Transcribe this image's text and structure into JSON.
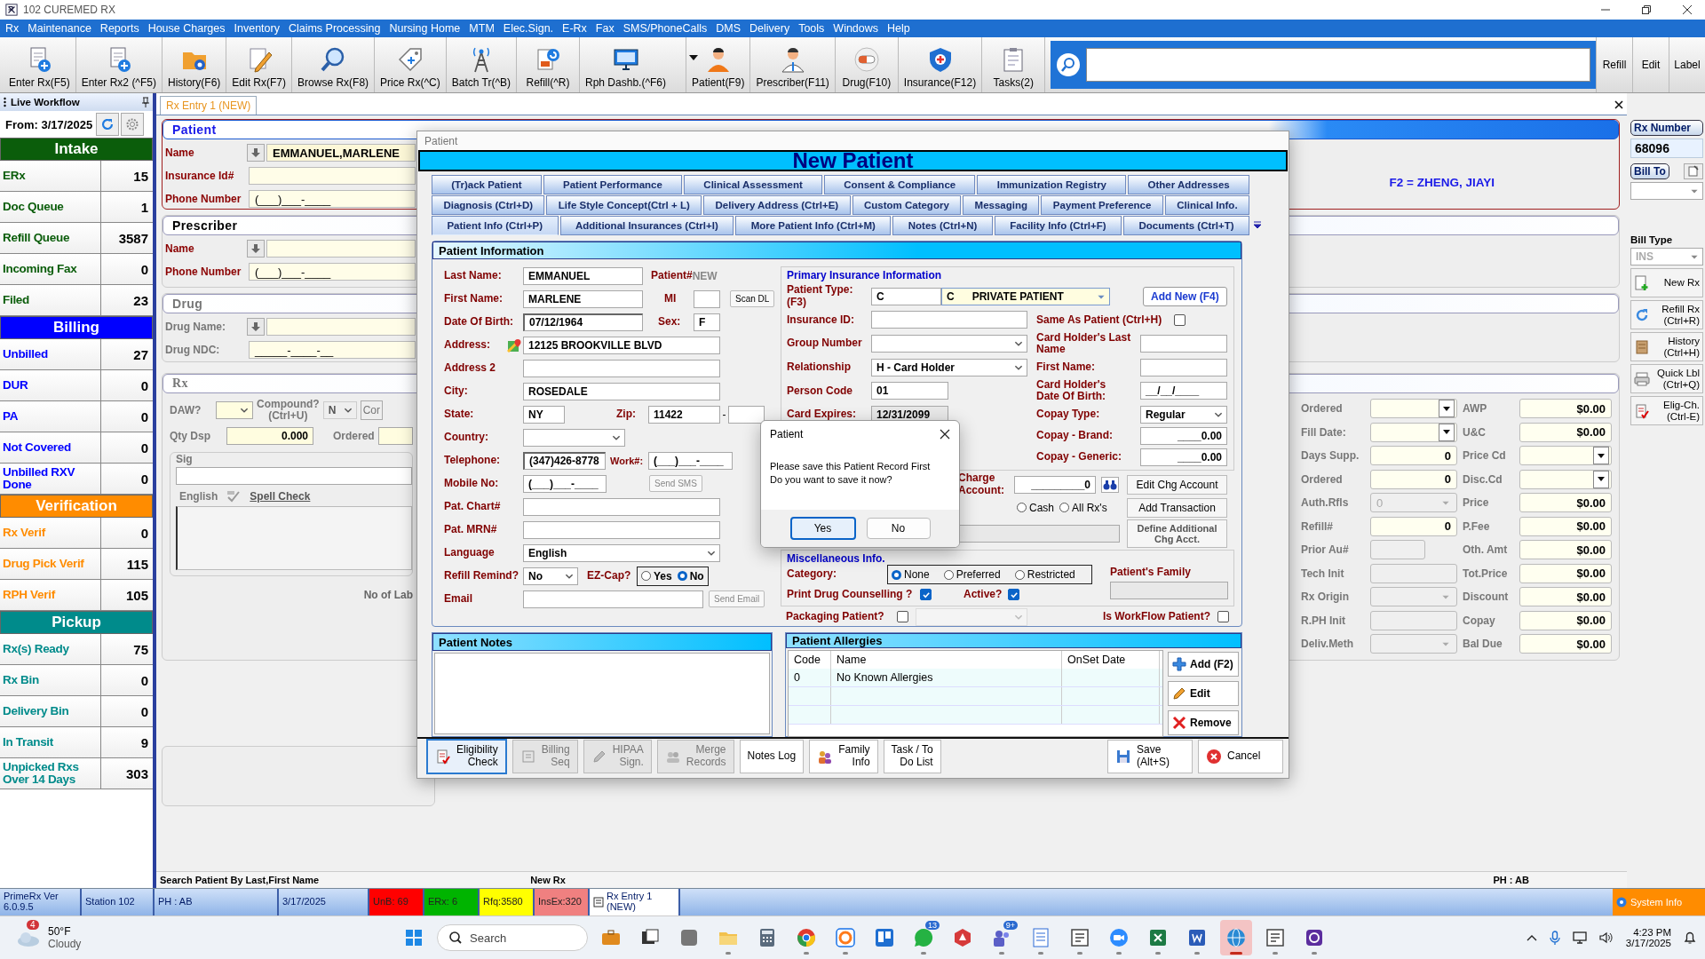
{
  "window": {
    "title": "102 CUREMED RX"
  },
  "menu": [
    "Rx",
    "Maintenance",
    "Reports",
    "House Charges",
    "Inventory",
    "Claims Processing",
    "Nursing Home",
    "MTM",
    "Elec.Sign.",
    "E-Rx",
    "Fax",
    "SMS/PhoneCalls",
    "DMS",
    "Delivery",
    "Tools",
    "Windows",
    "Help"
  ],
  "toolbar": [
    "Enter Rx(F5)",
    "Enter Rx2 (^F5)",
    "History(F6)",
    "Edit Rx(F7)",
    "Browse Rx(F8)",
    "Price Rx(^C)",
    "Batch Tr(^B)",
    "Refill(^R)",
    "Rph Dashb.(^F6)",
    "Patient(F9)",
    "Prescriber(F11)",
    "Drug(F10)",
    "Insurance(F12)",
    "Tasks(2)"
  ],
  "toolbar_buttons": [
    "Refill",
    "Edit",
    "Label"
  ],
  "sidebar": {
    "title": "Live Workflow",
    "from": "From: 3/17/2025",
    "groups": [
      {
        "title": "Intake",
        "color": "#0b5d0b",
        "items": [
          {
            "label": "ERx",
            "count": "15"
          },
          {
            "label": "Doc Queue",
            "count": "1"
          },
          {
            "label": "Refill Queue",
            "count": "3587"
          },
          {
            "label": "Incoming Fax",
            "count": "0"
          },
          {
            "label": "Filed",
            "count": "23"
          }
        ]
      },
      {
        "title": "Billing",
        "color": "#0000ff",
        "items": [
          {
            "label": "Unbilled",
            "count": "27"
          },
          {
            "label": "DUR",
            "count": "0"
          },
          {
            "label": "PA",
            "count": "0"
          },
          {
            "label": "Not Covered",
            "count": "0"
          },
          {
            "label": "Unbilled RXV Done",
            "count": "0"
          }
        ]
      },
      {
        "title": "Verification",
        "color": "#ff8c00",
        "items": [
          {
            "label": "Rx Verif",
            "count": "0"
          },
          {
            "label": "Drug Pick Verif",
            "count": "115"
          },
          {
            "label": "RPH Verif",
            "count": "105"
          }
        ]
      },
      {
        "title": "Pickup",
        "color": "#008b8b",
        "items": [
          {
            "label": "Rx(s) Ready",
            "count": "75"
          },
          {
            "label": "Rx Bin",
            "count": "0"
          },
          {
            "label": "Delivery Bin",
            "count": "0"
          },
          {
            "label": "In Transit",
            "count": "9"
          },
          {
            "label": "Unpicked Rxs Over 14 Days",
            "count": "303"
          }
        ]
      }
    ]
  },
  "tabs": [
    {
      "label": "Rx Entry 1 (NEW)",
      "selected": true
    }
  ],
  "patient_panel": {
    "title": "Patient",
    "fields": [
      {
        "label": "Name",
        "value": "EMMANUEL,MARLENE",
        "lookup": true
      },
      {
        "label": "Insurance Id#",
        "lookup": false
      },
      {
        "label": "Phone Number",
        "value": "(___)___-____",
        "lookup": false
      }
    ],
    "prescriber_note": "F2 = ZHENG, JIAYI"
  },
  "prescriber_panel": {
    "title": "Prescriber",
    "fields": [
      {
        "label": "Name",
        "lookup": true
      },
      {
        "label": "Phone Number",
        "value": "(___)___-____",
        "lookup": false
      }
    ]
  },
  "drug_panel": {
    "title": "Drug",
    "fields": [
      {
        "label": "Drug Name:",
        "lookup": true
      },
      {
        "label": "Drug NDC:",
        "value": "_____-____-__",
        "lookup": false
      }
    ]
  },
  "rx_panel": {
    "title": "Rx",
    "daw_label": "DAW?",
    "compound_label": "Compound?\n(Ctrl+U)",
    "compound_value": "N",
    "compound_button": "Cor",
    "qty_label": "Qty Dsp",
    "qty_value": "0.000",
    "ordered_label": "Ordered",
    "sig_label": "Sig",
    "language": "English",
    "spell_check": "Spell Check",
    "labels_text": "No of Lab"
  },
  "pricing": {
    "left": [
      {
        "label": "Ordered",
        "kind": "dropdown"
      },
      {
        "label": "Fill Date:",
        "kind": "dropdown"
      },
      {
        "label": "Days Supp.",
        "kind": "number",
        "value": "0"
      },
      {
        "label": "Ordered",
        "kind": "number",
        "value": "0"
      },
      {
        "label": "Auth.Rfls",
        "kind": "disabled",
        "value": "0"
      },
      {
        "label": "Refill#",
        "kind": "number",
        "value": "0"
      },
      {
        "label": "Prior Au#",
        "kind": "short"
      },
      {
        "label": "Tech Init",
        "kind": "blank"
      },
      {
        "label": "Rx Origin",
        "kind": "disabled"
      },
      {
        "label": "R.PH Init",
        "kind": "blank"
      },
      {
        "label": "Deliv.Meth",
        "kind": "disabled"
      }
    ],
    "right": [
      {
        "label": "AWP",
        "kind": "number",
        "value": "$0.00"
      },
      {
        "label": "U&C",
        "kind": "number",
        "value": "$0.00"
      },
      {
        "label": "Price Cd",
        "kind": "dropdown"
      },
      {
        "label": "Disc.Cd",
        "kind": "dropdown"
      },
      {
        "label": "Price",
        "kind": "number",
        "value": "$0.00"
      },
      {
        "label": "P.Fee",
        "kind": "number",
        "value": "$0.00"
      },
      {
        "label": "Oth. Amt",
        "kind": "number",
        "value": "$0.00"
      },
      {
        "label": "Tot.Price",
        "kind": "number",
        "value": "$0.00"
      },
      {
        "label": "Discount",
        "kind": "number",
        "value": "$0.00"
      },
      {
        "label": "Copay",
        "kind": "number",
        "value": "$0.00"
      },
      {
        "label": "Bal Due",
        "kind": "number",
        "value": "$0.00"
      }
    ]
  },
  "rail": {
    "rx_number_label": "Rx Number",
    "rx_number": "68096",
    "bill_to": "Bill To",
    "bill_type_label": "Bill Type",
    "bill_type": "INS",
    "actions": [
      "New Rx",
      "Refill Rx\n(Ctrl+R)",
      "History\n(Ctrl+H)",
      "Quick Lbl\n(Ctrl+Q)",
      "Elig-Ch.\n(Ctrl-E)"
    ]
  },
  "hints": [
    "Search Patient By Last,First Name",
    "New Rx",
    "PH : AB"
  ],
  "status_bar": [
    {
      "text": "PrimeRx Ver\n6.0.9.5"
    },
    {
      "text": "Station 102"
    },
    {
      "text": "PH : AB"
    },
    {
      "text": "3/17/2025"
    },
    {
      "text": "UnB: 69",
      "color": "#ff0000"
    },
    {
      "text": "ERx: 6",
      "color": "#00b400"
    },
    {
      "text": "Rfq:3580",
      "color": "#ffff00"
    },
    {
      "text": "InsEx:320",
      "color": "#f08080"
    },
    {
      "text": "Rx Entry 1\n(NEW)"
    }
  ],
  "system_info": "System Info",
  "taskbar": {
    "weather_badge": "4",
    "temperature": "50°F",
    "condition": "Cloudy",
    "search": {
      "placeholder": "Search"
    },
    "apps": [
      {
        "running": false,
        "selected": false
      },
      {
        "running": false,
        "selected": false
      },
      {
        "running": false,
        "selected": false
      },
      {
        "running": true,
        "selected": false
      },
      {
        "running": false,
        "selected": false
      },
      {
        "running": true,
        "selected": false
      },
      {
        "running": true,
        "selected": false
      },
      {
        "running": false,
        "selected": false
      },
      {
        "running": true,
        "selected": false,
        "badge": "13"
      },
      {
        "running": false,
        "selected": false
      },
      {
        "running": true,
        "selected": false,
        "badge": "9+"
      },
      {
        "running": true,
        "selected": false
      },
      {
        "running": true,
        "selected": false
      },
      {
        "running": true,
        "selected": false
      },
      {
        "running": true,
        "selected": false
      },
      {
        "running": true,
        "selected": false
      },
      {
        "running": true,
        "selected": true
      },
      {
        "running": true,
        "selected": false
      },
      {
        "running": true,
        "selected": false
      }
    ],
    "time": "4:23 PM",
    "date": "3/17/2025"
  },
  "dialog": {
    "title": "Patient",
    "heading": "New Patient",
    "tab_rows": [
      [
        {
          "label": "(Tr)ack Patient",
          "selected": false
        },
        {
          "label": "Patient Performance",
          "selected": false
        },
        {
          "label": "Clinical Assessment",
          "selected": false
        },
        {
          "label": "Consent & Compliance",
          "selected": false
        },
        {
          "label": "Immunization Registry",
          "selected": false
        },
        {
          "label": "Other Addresses",
          "selected": false
        }
      ],
      [
        {
          "label": "Diagnosis (Ctrl+D)",
          "selected": false
        },
        {
          "label": "Life Style Concept(Ctrl + L)",
          "selected": false
        },
        {
          "label": "Delivery Address (Ctrl+E)",
          "selected": false
        },
        {
          "label": "Custom Category",
          "selected": false
        },
        {
          "label": "Messaging",
          "selected": false
        },
        {
          "label": "Payment Preference",
          "selected": false
        },
        {
          "label": "Clinical Info.",
          "selected": false
        }
      ],
      [
        {
          "label": "Patient Info (Ctrl+P)",
          "selected": true
        },
        {
          "label": "Additional Insurances (Ctrl+I)",
          "selected": false
        },
        {
          "label": "More Patient Info (Ctrl+M)",
          "selected": false
        },
        {
          "label": "Notes (Ctrl+N)",
          "selected": false
        },
        {
          "label": "Facility Info (Ctrl+F)",
          "selected": false
        },
        {
          "label": "Documents (Ctrl+T)",
          "selected": false
        }
      ]
    ],
    "section_title": "Patient Information",
    "patient": {
      "last_name": {
        "label": "Last Name:",
        "value": "EMMANUEL"
      },
      "patient_no_label": "Patient#",
      "patient_no": "NEW",
      "first_name": {
        "label": "First Name:",
        "value": "MARLENE"
      },
      "mi_label": "MI",
      "scan_dl": "Scan DL",
      "dob": {
        "label": "Date Of Birth:",
        "value": "07/12/1964"
      },
      "sex": {
        "label": "Sex:",
        "value": "F"
      },
      "address": {
        "label": "Address:",
        "value": "12125 BROOKVILLE BLVD"
      },
      "address2": {
        "label": "Address 2"
      },
      "city": {
        "label": "City:",
        "value": "ROSEDALE"
      },
      "state": {
        "label": "State:",
        "value": "NY"
      },
      "zip": {
        "label": "Zip:",
        "value": "11422"
      },
      "zip_separator": "-",
      "country": {
        "label": "Country:"
      },
      "telephone": {
        "label": "Telephone:",
        "value": "(347)426-8778"
      },
      "work": {
        "label": "Work#:",
        "value": "(___)___-____"
      },
      "mobile": {
        "label": "Mobile No:",
        "value": "(___)___-____"
      },
      "send_sms": "Send SMS",
      "chart": {
        "label": "Pat. Chart#"
      },
      "mrn": {
        "label": "Pat. MRN#"
      },
      "language": {
        "label": "Language",
        "value": "English"
      },
      "refill_remind": {
        "label": "Refill Remind?",
        "value": "No"
      },
      "ez_cap": {
        "label": "EZ-Cap?",
        "options": [
          {
            "label": "Yes",
            "selected": false
          },
          {
            "label": "No",
            "selected": true
          }
        ]
      },
      "email": {
        "label": "Email"
      },
      "send_email": "Send Email"
    },
    "insurance": {
      "title": "Primary Insurance Information",
      "patient_type": {
        "label": "Patient Type:\n(F3)",
        "code": "C",
        "select_code": "C",
        "select_name": "PRIVATE PATIENT"
      },
      "add_new": "Add New (F4)",
      "insurance_id": {
        "label": "Insurance ID:"
      },
      "group_number": {
        "label": "Group Number"
      },
      "relationship": {
        "label": "Relationship",
        "value": "H - Card Holder"
      },
      "person_code": {
        "label": "Person Code",
        "value": "01"
      },
      "card_expires": {
        "label": "Card Expires:",
        "value": "12/31/2099"
      },
      "same_as_patient": {
        "label": "Same As Patient (Ctrl+H)",
        "checked": false
      },
      "holder_last": {
        "label": "Card Holder's Last\nName"
      },
      "holder_first": {
        "label": "First Name:"
      },
      "holder_dob": {
        "label": "Card Holder's\nDate Of Birth:",
        "value": "__/__/____"
      },
      "copay_type": {
        "label": "Copay Type:",
        "value": "Regular"
      },
      "copay_brand": {
        "label": "Copay - Brand:",
        "value": "____0.00"
      },
      "copay_generic": {
        "label": "Copay - Generic:",
        "value": "____0.00"
      }
    },
    "charge": {
      "label": "Charge\nAccount:",
      "value": "_________0",
      "edit": "Edit Chg Account",
      "options": [
        {
          "label": "Cash",
          "selected": false
        },
        {
          "label": "All Rx's",
          "selected": false
        }
      ],
      "add_transaction": "Add Transaction",
      "define": "Define Additional\nChg Acct."
    },
    "misc": {
      "title": "Miscellaneous Info.",
      "category_label": "Category:",
      "categories": [
        {
          "label": "None",
          "selected": true
        },
        {
          "label": "Preferred",
          "selected": false
        },
        {
          "label": "Restricted",
          "selected": false
        }
      ],
      "family_label": "Patient's Family",
      "print_counselling": {
        "label": "Print Drug Counselling ?",
        "checked": true
      },
      "active": {
        "label": "Active?",
        "checked": true
      },
      "packaging": {
        "label": "Packaging Patient?",
        "checked": false
      },
      "workflow": {
        "label": "Is WorkFlow Patient?",
        "checked": false
      }
    },
    "notes_title": "Patient Notes",
    "allergies": {
      "title": "Patient Allergies",
      "columns": [
        "Code",
        "Name",
        "OnSet Date"
      ],
      "rows": [
        {
          "code": "0",
          "name": "No Known Allergies"
        }
      ],
      "buttons": [
        "Add (F2)",
        "Edit",
        "Remove"
      ]
    },
    "footer_buttons": [
      {
        "label": "Eligibility\nCheck",
        "disabled": false
      },
      {
        "label": "Billing\nSeq",
        "disabled": true
      },
      {
        "label": "HIPAA\nSign.",
        "disabled": true
      },
      {
        "label": "Merge\nRecords",
        "disabled": true
      },
      {
        "label": "Notes Log",
        "disabled": false
      },
      {
        "label": "Family\nInfo",
        "disabled": false
      },
      {
        "label": "Task / To\nDo List",
        "disabled": false
      }
    ],
    "save": "Save\n(Alt+S)",
    "cancel": "Cancel"
  },
  "message_box": {
    "title": "Patient",
    "text": "Please save this Patient Record First\nDo you want to save it now?",
    "buttons": [
      {
        "label": "Yes",
        "default": true
      },
      {
        "label": "No",
        "default": false
      }
    ]
  }
}
